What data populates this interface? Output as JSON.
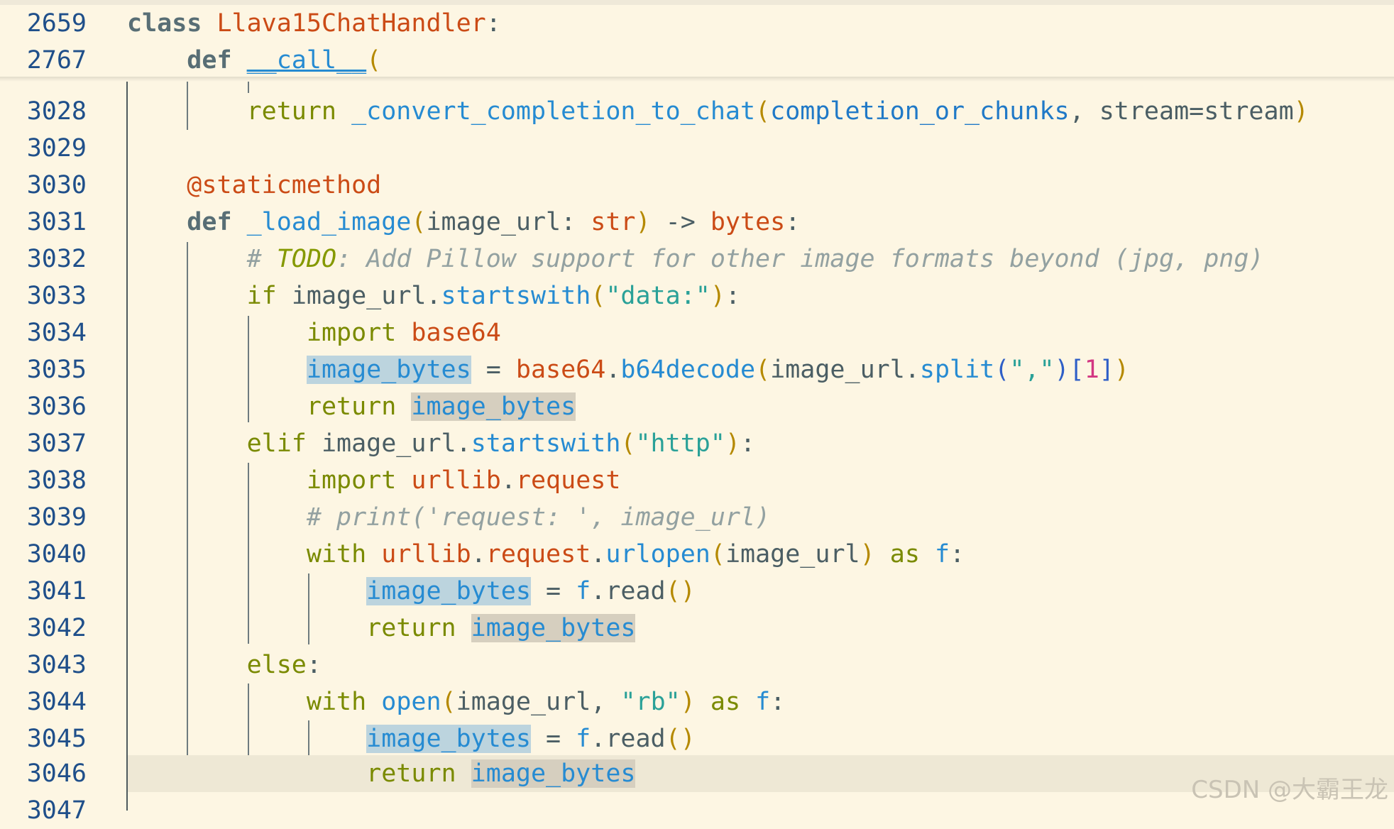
{
  "sticky_header": [
    {
      "number": "2659",
      "kw": "class",
      "name": "Llava15ChatHandler",
      "tail": ":"
    },
    {
      "number": "2767",
      "kw": "def",
      "name": "__call__",
      "tail": "("
    }
  ],
  "lines": {
    "n3028": "3028",
    "n3029": "3029",
    "n3030": "3030",
    "n3031": "3031",
    "n3032": "3032",
    "n3033": "3033",
    "n3034": "3034",
    "n3035": "3035",
    "n3036": "3036",
    "n3037": "3037",
    "n3038": "3038",
    "n3039": "3039",
    "n3040": "3040",
    "n3041": "3041",
    "n3042": "3042",
    "n3043": "3043",
    "n3044": "3044",
    "n3045": "3045",
    "n3046": "3046",
    "n3047": "3047"
  },
  "tokens": {
    "return": "return",
    "convert_fn": "_convert_completion_to_chat",
    "convert_arg1": "completion_or_chunks",
    "convert_rest": ", stream=stream",
    "decorator": "@staticmethod",
    "def": "def",
    "load_fn": "_load_image",
    "load_params": "image_url: ",
    "str_type": "str",
    "arrow": " -> ",
    "bytes_type": "bytes",
    "comment_hash": "# ",
    "todo": "TODO",
    "comment_rest": ": Add Pillow support for other image formats beyond (jpg, png)",
    "if": "if",
    "image_url": "image_url",
    "startswith": "startswith",
    "data_str": "\"data:\"",
    "import": "import",
    "base64": "base64",
    "image_bytes": "image_bytes",
    "b64decode": "b64decode",
    "split": "split",
    "comma_str": "\",\"",
    "one": "1",
    "elif": "elif",
    "http_str": "\"http\"",
    "urllib": "urllib",
    "request": "request",
    "print_comment": "# print('request: ', image_url)",
    "with": "with",
    "urlopen": "urlopen",
    "as": "as",
    "f": "f",
    "read": "read",
    "else": "else",
    "open": "open",
    "rb_str": "\"rb\""
  },
  "watermark": "CSDN @大霸王龙"
}
